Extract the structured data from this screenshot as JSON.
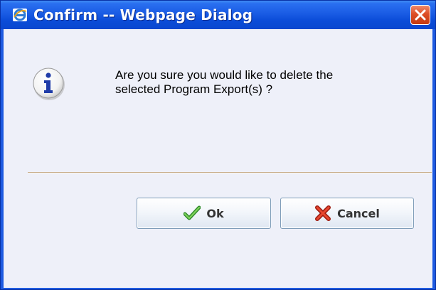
{
  "window": {
    "title": "Confirm -- Webpage Dialog",
    "icon": "ie-icon",
    "close_icon": "close-icon"
  },
  "dialog": {
    "icon": "info-icon",
    "message_line1": "Are you sure you would like to delete the",
    "message_line2": "selected Program Export(s) ?"
  },
  "buttons": {
    "ok_label": "Ok",
    "ok_icon": "checkmark-icon",
    "cancel_label": "Cancel",
    "cancel_icon": "red-x-icon"
  },
  "colors": {
    "titlebar": "#0b4cd8",
    "client_bg": "#eef0f9",
    "close_button": "#d9502a"
  }
}
